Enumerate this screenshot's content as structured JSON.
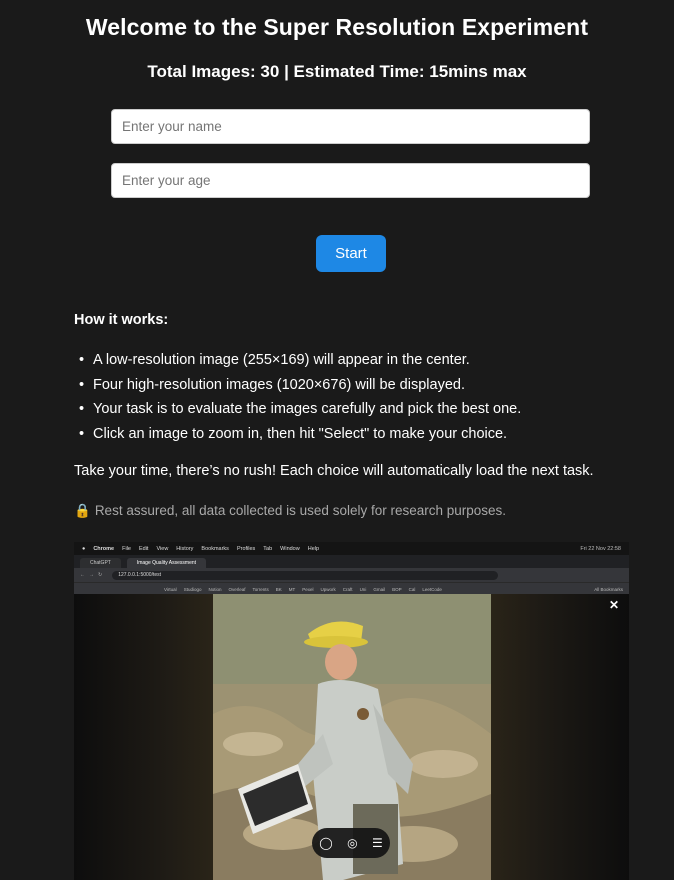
{
  "header": {
    "title": "Welcome to the Super Resolution Experiment",
    "subtitle": "Total Images: 30 | Estimated Time: 15mins max"
  },
  "form": {
    "name_placeholder": "Enter your name",
    "name_value": "",
    "age_placeholder": "Enter your age",
    "age_value": "",
    "start_label": "Start"
  },
  "instructions": {
    "title": "How it works:",
    "steps": [
      "A low-resolution image (255×169) will appear in the center.",
      "Four high-resolution images (1020×676) will be displayed.",
      "Your task is to evaluate the images carefully and pick the best one.",
      "Click an image to zoom in, then hit \"Select\" to make your choice."
    ],
    "note": "Take your time, there’s no rush! Each choice will automatically load the next task.",
    "privacy_icon": "lock-icon",
    "privacy": "Rest assured, all data collected is used solely for research purposes."
  },
  "colors": {
    "background": "#1a1a1a",
    "accent": "#1e88e5",
    "muted_text": "#a8a8a8"
  },
  "screenshot": {
    "menubar": [
      "Chrome",
      "File",
      "Edit",
      "View",
      "History",
      "Bookmarks",
      "Profiles",
      "Tab",
      "Window",
      "Help"
    ],
    "clock": "Fri 22 Nov 22:58",
    "tabs": [
      "ChatGPT",
      "Image Quality Assessment"
    ],
    "url": "127.0.0.1:5000/test",
    "bookmarks": [
      "Virtual",
      "Studiogo",
      "Notion",
      "Overleaf",
      "Torrents",
      "BK",
      "MT",
      "Pexel",
      "Upwork",
      "Craft",
      "Uni",
      "Gmail",
      "BOP",
      "Cal",
      "LeetCode"
    ],
    "bookmarks_right": "All Bookmarks",
    "close_icon": "close-icon",
    "toolbar_icons": [
      "chat-icon",
      "eye-icon",
      "menu-icon"
    ]
  }
}
